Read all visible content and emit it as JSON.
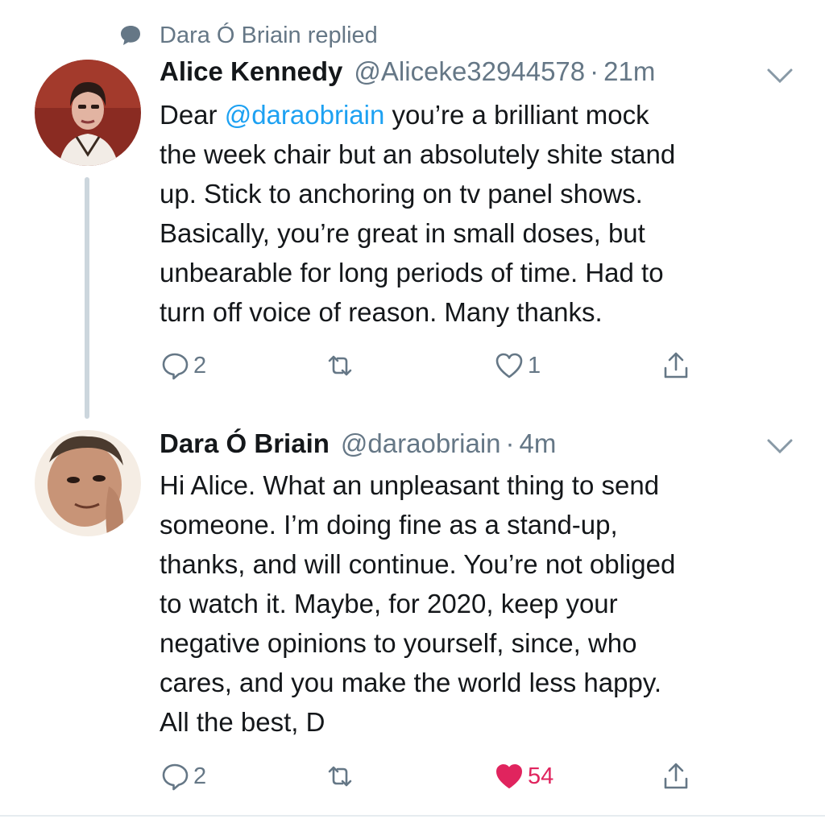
{
  "context": {
    "icon": "speech-bubble-icon",
    "text": "Dara Ó Briain replied"
  },
  "tweets": [
    {
      "name": "Alice Kennedy",
      "handle": "@Aliceke32944578",
      "dot": "·",
      "time": "21m",
      "body_prefix": "Dear ",
      "mention": "@daraobriain",
      "body_rest": " you’re a brilliant mock\nthe week chair but an absolutely shite stand\nup. Stick to anchoring on tv panel shows.\nBasically, you’re great in small doses, but\nunbearable for long periods of time. Had to\nturn off voice of reason. Many thanks.",
      "replies": "2",
      "likes": "1",
      "liked": false
    },
    {
      "name": "Dara Ó Briain",
      "handle": "@daraobriain",
      "dot": "·",
      "time": "4m",
      "body": "Hi Alice. What an unpleasant thing to send\nsomeone. I’m doing fine as a stand-up,\nthanks, and will continue. You’re not obliged\nto watch it. Maybe, for 2020, keep your\nnegative opinions to yourself, since, who\ncares, and you make the world less happy.\nAll the best, D",
      "replies": "2",
      "likes": "54",
      "liked": true
    }
  ],
  "colors": {
    "accent": "#1da1f2",
    "like": "#e0245e",
    "muted": "#657786",
    "thread": "#ccd6dd"
  }
}
